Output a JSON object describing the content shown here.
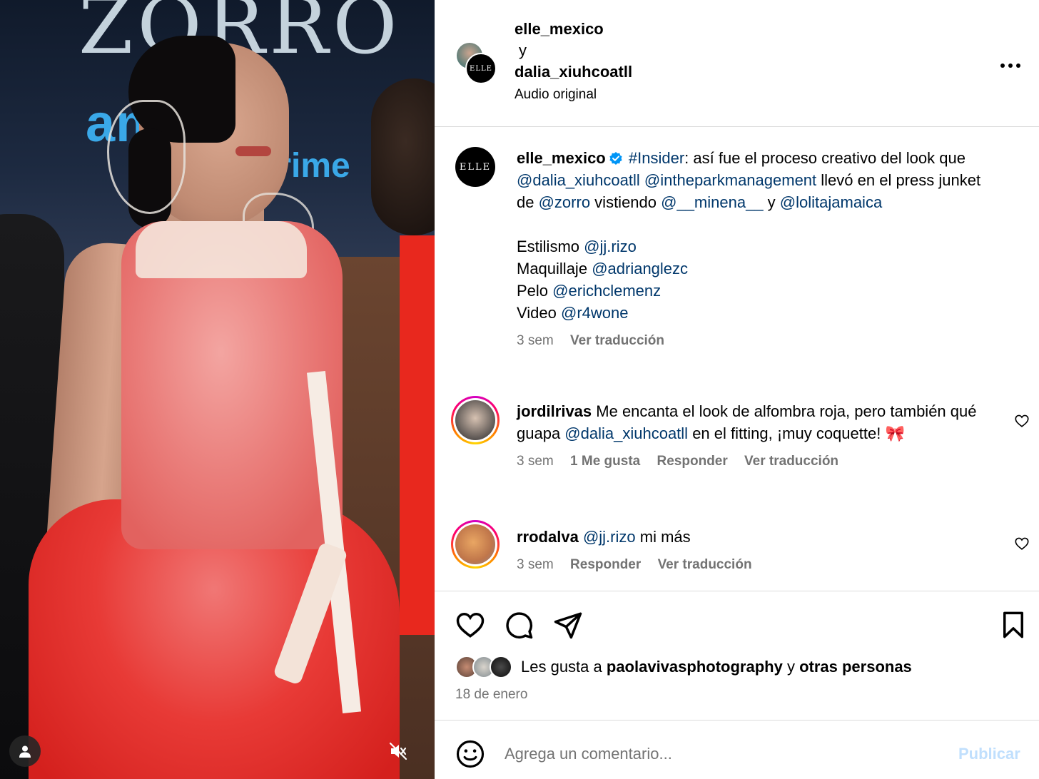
{
  "media": {
    "banner_text": "ZORRO",
    "sponsor_text_1": "amazon",
    "sponsor_text_2": "prime"
  },
  "header": {
    "user1": "elle_mexico",
    "joiner": "y",
    "user2": "dalia_xiuhcoatll",
    "audio": "Audio original",
    "avatar_logo": "ELLE",
    "more_icon": "more-horizontal-icon"
  },
  "caption": {
    "avatar_logo": "ELLE",
    "username": "elle_mexico",
    "hashtag": "#Insider",
    "text_1": ": así fue el proceso creativo del look que ",
    "mention_1": "@dalia_xiuhcoatll",
    "mention_2": "@intheparkmanagement",
    "text_2": " llevó en el press junket de ",
    "mention_3": "@zorro",
    "text_3": " vistiendo ",
    "mention_4": "@__minena__",
    "text_4": " y ",
    "mention_5": "@lolitajamaica",
    "credits": [
      {
        "label": "Estilismo",
        "mention": "@jj.rizo"
      },
      {
        "label": "Maquillaje",
        "mention": "@adrianglezc"
      },
      {
        "label": "Pelo",
        "mention": "@erichclemenz"
      },
      {
        "label": "Video",
        "mention": "@r4wone"
      }
    ],
    "time": "3 sem",
    "translate": "Ver traducción"
  },
  "comments": [
    {
      "username": "jordilrivas",
      "text_1": " Me encanta el look de alfombra roja, pero también qué guapa ",
      "mention": "@dalia_xiuhcoatll",
      "text_2": " en el fitting, ¡muy coquette! 🎀",
      "time": "3 sem",
      "likes": "1 Me gusta",
      "reply": "Responder",
      "translate": "Ver traducción"
    },
    {
      "username": "rrodalva",
      "mention": "@jj.rizo",
      "text": " mi más",
      "time": "3 sem",
      "reply": "Responder",
      "translate": "Ver traducción"
    }
  ],
  "actions": {
    "likes_prefix": "Les gusta a ",
    "likes_user": "paolavivasphotography",
    "likes_joiner": " y ",
    "likes_others": "otras personas",
    "date": "18 de enero"
  },
  "composer": {
    "placeholder": "Agrega un comentario...",
    "publish": "Publicar"
  },
  "colors": {
    "link": "#00376b",
    "verified": "#0095f6",
    "muted": "#737373",
    "publish_disabled": "#c0dffd"
  }
}
